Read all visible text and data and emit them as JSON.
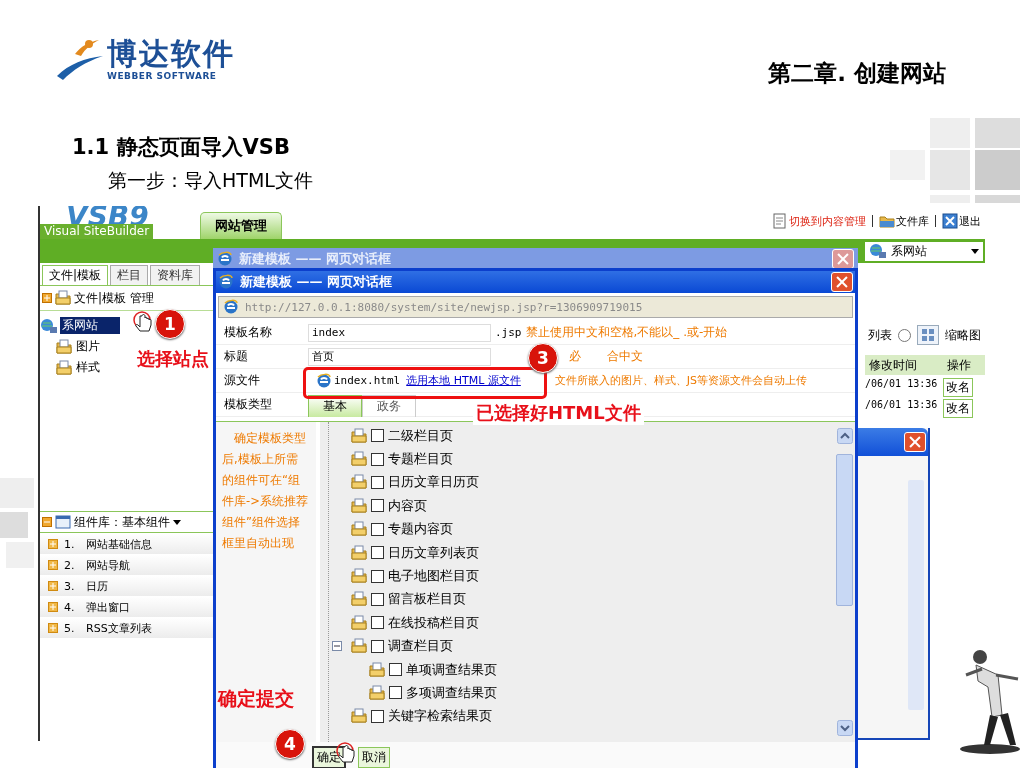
{
  "slide": {
    "logo": {
      "name": "博达软件",
      "subtitle": "WEBBER SOFTWARE"
    },
    "chapter": "第二章. 创建网站",
    "section": "1.1 静态页面导入VSB",
    "step": "第一步：导入HTML文件"
  },
  "app": {
    "logo": {
      "mark": "VSB9",
      "name": "Visual SiteBuilder"
    },
    "tabs": [
      {
        "label": "网站管理",
        "selected": true
      }
    ],
    "top_links": [
      "切换到内容管理",
      "文件库",
      "退出"
    ],
    "site_selector": "系网站",
    "left_tabs": [
      {
        "label": "文件|模板",
        "selected": true
      },
      {
        "label": "栏目",
        "selected": false
      },
      {
        "label": "资料库",
        "selected": false
      }
    ],
    "tree_header": "文件|模板 管理",
    "tree": [
      {
        "label": "系网站",
        "selected": true,
        "children": [
          {
            "label": "图片",
            "selected": false
          },
          {
            "label": "样式",
            "selected": false
          }
        ]
      }
    ],
    "components": {
      "title": "组件库：基本组件",
      "items": [
        {
          "number": "1.",
          "label": "网站基础信息"
        },
        {
          "number": "2.",
          "label": "网站导航"
        },
        {
          "number": "3.",
          "label": "日历"
        },
        {
          "number": "4.",
          "label": "弹出窗口"
        },
        {
          "number": "5.",
          "label": "RSS文章列表"
        }
      ]
    },
    "view": {
      "list_label": "列表",
      "option": {
        "label": "缩略图",
        "selected": false
      }
    },
    "table": {
      "columns": [
        "修改时间",
        "操作"
      ],
      "rows": [
        {
          "modified": "/06/01 13:36",
          "action": "改名"
        },
        {
          "modified": "/06/01 13:36",
          "action": "改名"
        }
      ]
    }
  },
  "back_dialog": {
    "title": "新建模板 —— 网页对话框"
  },
  "dialog": {
    "title": "新建模板 —— 网页对话框",
    "address": "http://127.0.0.1:8080/system/site/newjsp.jsp?r=1306909719015",
    "name_field": {
      "label": "模板名称",
      "value": "index",
      "suffix": ".jsp",
      "hint": "禁止使用中文和空格,不能以_ .或-开始"
    },
    "title_field": {
      "label": "标题",
      "value": "首页",
      "hint_start": "必",
      "hint_end": "合中文"
    },
    "source": {
      "label": "源文件",
      "file": "index.html",
      "link": "选用本地 HTML 源文件",
      "hint": "文件所嵌入的图片、样式、JS等资源文件会自动上传"
    },
    "type": {
      "label": "模板类型",
      "tabs": [
        {
          "label": "基本",
          "selected": true
        },
        {
          "label": "政务",
          "selected": false
        }
      ]
    },
    "note": "确定模板类型后,模板上所需的组件可在“组件库->系统推荐组件”组件选择框里自动出现",
    "pages": [
      {
        "label": "二级栏目页",
        "checked": false
      },
      {
        "label": "专题栏目页",
        "checked": false
      },
      {
        "label": "日历文章日历页",
        "checked": false
      },
      {
        "label": "内容页",
        "checked": false
      },
      {
        "label": "专题内容页",
        "checked": false
      },
      {
        "label": "日历文章列表页",
        "checked": false
      },
      {
        "label": "电子地图栏目页",
        "checked": false
      },
      {
        "label": "留言板栏目页",
        "checked": false
      },
      {
        "label": "在线投稿栏目页",
        "checked": false
      },
      {
        "label": "调查栏目页",
        "checked": false,
        "expanded": true,
        "children": [
          {
            "label": "单项调查结果页",
            "checked": false
          },
          {
            "label": "多项调查结果页",
            "checked": false
          }
        ]
      },
      {
        "label": "关键字检索结果页",
        "checked": false
      }
    ],
    "buttons": [
      "确定",
      "取消"
    ]
  },
  "annotations": {
    "select_site": {
      "badge": "1",
      "caption": "选择站点"
    },
    "source_selected": {
      "badge": "3",
      "caption": "已选择好HTML文件"
    },
    "submit": {
      "badge": "4",
      "caption": "确定提交"
    }
  }
}
